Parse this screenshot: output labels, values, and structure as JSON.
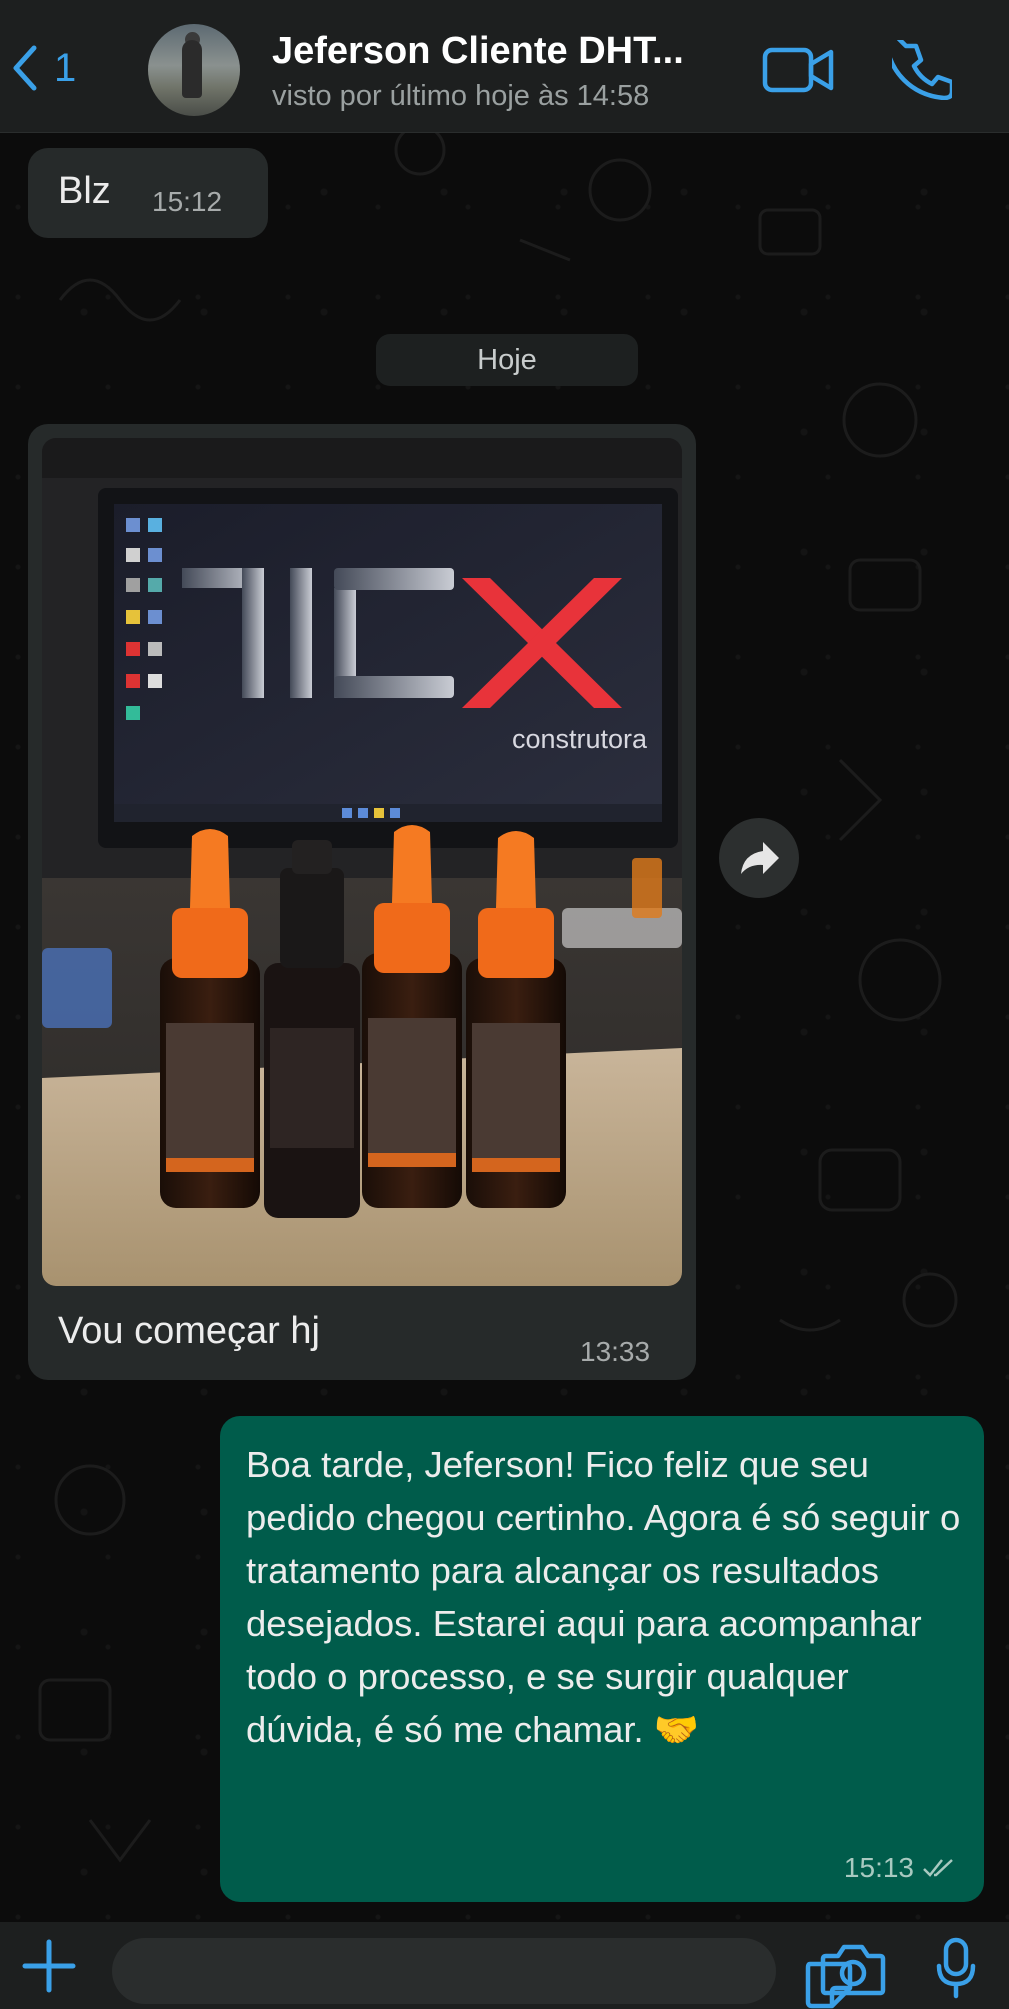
{
  "header": {
    "back_count": "1",
    "contact_name": "Jeferson Cliente DHT...",
    "status": "visto por último hoje às 14:58"
  },
  "messages": [
    {
      "direction": "in",
      "text": "Blz",
      "time": "15:12"
    },
    {
      "direction": "system",
      "text": "Hoje"
    },
    {
      "direction": "in",
      "type": "image",
      "image_text": {
        "logo": "construtora"
      },
      "caption": "Vou começar hj",
      "time": "13:33"
    },
    {
      "direction": "out",
      "text": "Boa tarde, Jeferson! Fico feliz que seu pedido chegou certinho. Agora é só seguir o tratamento para alcançar os resultados desejados. Estarei aqui para acompanhar todo o processo, e se surgir qualquer dúvida, é só me chamar. 🤝",
      "time": "15:13",
      "status": "read"
    }
  ],
  "colors": {
    "header_bg": "#1d1f1f",
    "incoming_bubble": "#262a2a",
    "outgoing_bubble": "#005c4b",
    "accent_blue": "#3aa0e8",
    "logo_red": "#e8333a"
  },
  "icons": {
    "back": "chevron-left-icon",
    "video": "video-call-icon",
    "call": "phone-icon",
    "forward": "forward-icon",
    "plus": "plus-icon",
    "sticker": "sticker-icon",
    "camera": "camera-icon",
    "mic": "microphone-icon",
    "read": "double-check-icon"
  }
}
